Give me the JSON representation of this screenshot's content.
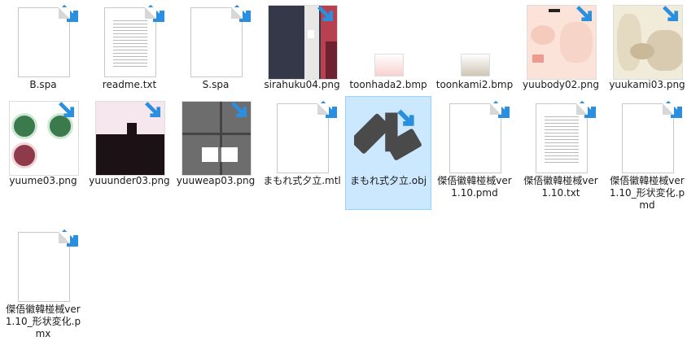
{
  "files": [
    {
      "name": "B.spa",
      "kind": "file"
    },
    {
      "name": "readme.txt",
      "kind": "text"
    },
    {
      "name": "S.spa",
      "kind": "file"
    },
    {
      "name": "sirahuku04.png",
      "kind": "image"
    },
    {
      "name": "toonhada2.bmp",
      "kind": "image"
    },
    {
      "name": "toonkami2.bmp",
      "kind": "image"
    },
    {
      "name": "yuubody02.png",
      "kind": "image"
    },
    {
      "name": "yuukami03.png",
      "kind": "image"
    },
    {
      "name": "yuume03.png",
      "kind": "image"
    },
    {
      "name": "yuuunder03.png",
      "kind": "image"
    },
    {
      "name": "yuuweap03.png",
      "kind": "image"
    },
    {
      "name": "まもれ式夕立.mtl",
      "kind": "file"
    },
    {
      "name": "まもれ式夕立.obj",
      "kind": "obj",
      "selected": true
    },
    {
      "name": "傑俉徽韓椪棫ver1.10.pmd",
      "kind": "file"
    },
    {
      "name": "傑俉徽韓椪棫ver1.10.txt",
      "kind": "text"
    },
    {
      "name": "傑俉徽韓椪棫ver1.10_形状変化.pmd",
      "kind": "file"
    },
    {
      "name": "傑俉徽韓椪棫ver1.10_形状変化.pmx",
      "kind": "file"
    }
  ],
  "colors": {
    "selection_bg": "#cce8ff",
    "selection_border": "#99d1ff",
    "arrow": "#2b8fe0"
  }
}
